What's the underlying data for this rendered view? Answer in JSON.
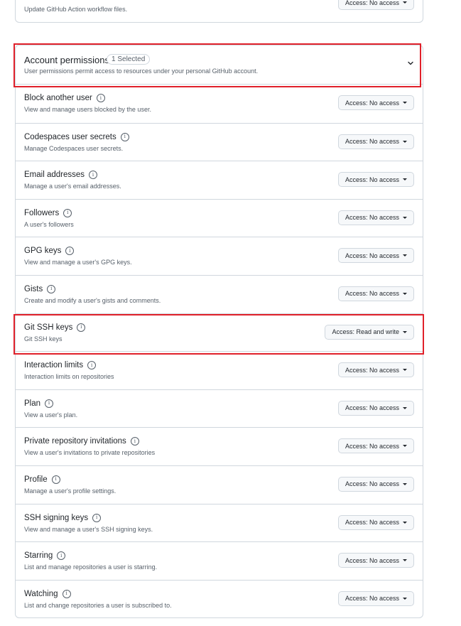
{
  "top_partial": {
    "description": "Update GitHub Action workflow files.",
    "access": "Access: No access"
  },
  "account_permissions": {
    "title": "Account permissions",
    "badge": "1 Selected",
    "description": "User permissions permit access to resources under your personal GitHub account."
  },
  "permissions": [
    {
      "name": "Block another user",
      "description": "View and manage users blocked by the user.",
      "access": "Access: No access"
    },
    {
      "name": "Codespaces user secrets",
      "description": "Manage Codespaces user secrets.",
      "access": "Access: No access"
    },
    {
      "name": "Email addresses",
      "description": "Manage a user's email addresses.",
      "access": "Access: No access"
    },
    {
      "name": "Followers",
      "description": "A user's followers",
      "access": "Access: No access"
    },
    {
      "name": "GPG keys",
      "description": "View and manage a user's GPG keys.",
      "access": "Access: No access"
    },
    {
      "name": "Gists",
      "description": "Create and modify a user's gists and comments.",
      "access": "Access: No access"
    },
    {
      "name": "Git SSH keys",
      "description": "Git SSH keys",
      "access": "Access: Read and write"
    },
    {
      "name": "Interaction limits",
      "description": "Interaction limits on repositories",
      "access": "Access: No access"
    },
    {
      "name": "Plan",
      "description": "View a user's plan.",
      "access": "Access: No access"
    },
    {
      "name": "Private repository invitations",
      "description": "View a user's invitations to private repositories",
      "access": "Access: No access"
    },
    {
      "name": "Profile",
      "description": "Manage a user's profile settings.",
      "access": "Access: No access"
    },
    {
      "name": "SSH signing keys",
      "description": "View and manage a user's SSH signing keys.",
      "access": "Access: No access"
    },
    {
      "name": "Starring",
      "description": "List and manage repositories a user is starring.",
      "access": "Access: No access"
    },
    {
      "name": "Watching",
      "description": "List and change repositories a user is subscribed to.",
      "access": "Access: No access"
    }
  ],
  "icons": {
    "info": "info-icon",
    "chevron": "chevron-down-icon",
    "caret": "caret-down-icon"
  },
  "colors": {
    "highlight": "#e0202a",
    "border": "#d0d7de",
    "muted_text": "#57606a"
  }
}
